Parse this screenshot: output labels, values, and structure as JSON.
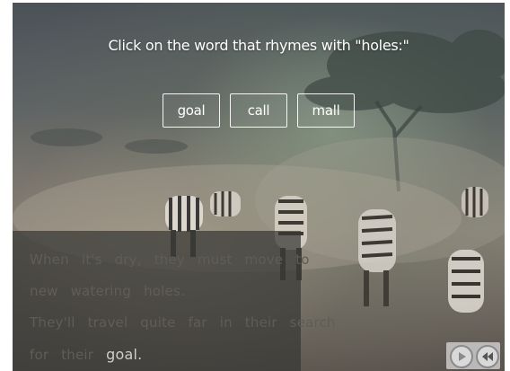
{
  "activity": {
    "prompt": "Click on the word that rhymes with \"holes:\"",
    "choices": [
      {
        "label": "goal"
      },
      {
        "label": "call"
      },
      {
        "label": "mall"
      }
    ]
  },
  "passage": {
    "line1": "When it's dry, they must move to",
    "line2": "new watering holes.",
    "line3": "They'll travel quite far in their search",
    "line4_prefix": "for their",
    "highlight": "goal."
  },
  "navigation": {
    "play_icon": "play-icon",
    "rewind_icon": "rewind-icon"
  },
  "colors": {
    "prompt_text": "#ffffff",
    "panel_bg": "#37372f",
    "passage_text_dim": "#5f5d55",
    "highlight_text": "#cfcfc9"
  }
}
